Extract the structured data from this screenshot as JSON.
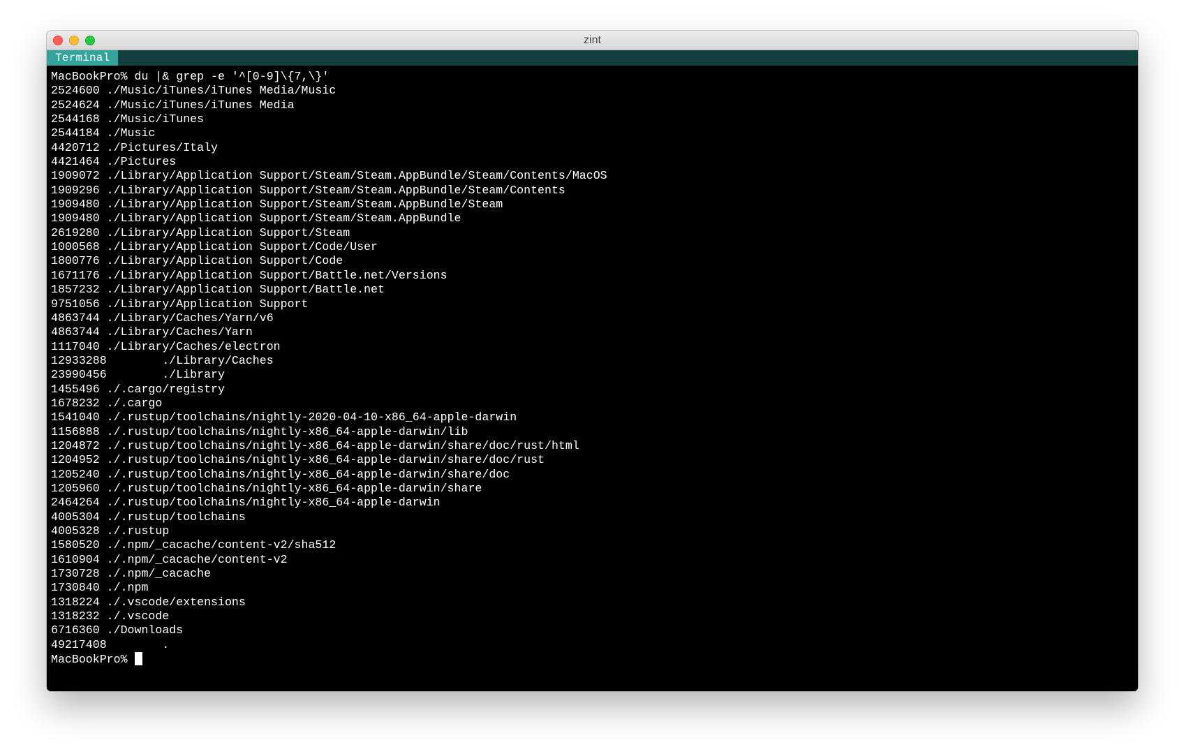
{
  "window": {
    "title": "zint",
    "tab_label": "Terminal"
  },
  "terminal": {
    "command_line": "MacBookPro% du |& grep -e '^[0-9]\\{7,\\}'",
    "output": [
      "2524600 ./Music/iTunes/iTunes Media/Music",
      "2524624 ./Music/iTunes/iTunes Media",
      "2544168 ./Music/iTunes",
      "2544184 ./Music",
      "4420712 ./Pictures/Italy",
      "4421464 ./Pictures",
      "1909072 ./Library/Application Support/Steam/Steam.AppBundle/Steam/Contents/MacOS",
      "1909296 ./Library/Application Support/Steam/Steam.AppBundle/Steam/Contents",
      "1909480 ./Library/Application Support/Steam/Steam.AppBundle/Steam",
      "1909480 ./Library/Application Support/Steam/Steam.AppBundle",
      "2619280 ./Library/Application Support/Steam",
      "1000568 ./Library/Application Support/Code/User",
      "1800776 ./Library/Application Support/Code",
      "1671176 ./Library/Application Support/Battle.net/Versions",
      "1857232 ./Library/Application Support/Battle.net",
      "9751056 ./Library/Application Support",
      "4863744 ./Library/Caches/Yarn/v6",
      "4863744 ./Library/Caches/Yarn",
      "1117040 ./Library/Caches/electron",
      "12933288        ./Library/Caches",
      "23990456        ./Library",
      "1455496 ./.cargo/registry",
      "1678232 ./.cargo",
      "1541040 ./.rustup/toolchains/nightly-2020-04-10-x86_64-apple-darwin",
      "1156888 ./.rustup/toolchains/nightly-x86_64-apple-darwin/lib",
      "1204872 ./.rustup/toolchains/nightly-x86_64-apple-darwin/share/doc/rust/html",
      "1204952 ./.rustup/toolchains/nightly-x86_64-apple-darwin/share/doc/rust",
      "1205240 ./.rustup/toolchains/nightly-x86_64-apple-darwin/share/doc",
      "1205960 ./.rustup/toolchains/nightly-x86_64-apple-darwin/share",
      "2464264 ./.rustup/toolchains/nightly-x86_64-apple-darwin",
      "4005304 ./.rustup/toolchains",
      "4005328 ./.rustup",
      "1580520 ./.npm/_cacache/content-v2/sha512",
      "1610904 ./.npm/_cacache/content-v2",
      "1730728 ./.npm/_cacache",
      "1730840 ./.npm",
      "1318224 ./.vscode/extensions",
      "1318232 ./.vscode",
      "6716360 ./Downloads",
      "49217408        ."
    ],
    "prompt": "MacBookPro% "
  }
}
